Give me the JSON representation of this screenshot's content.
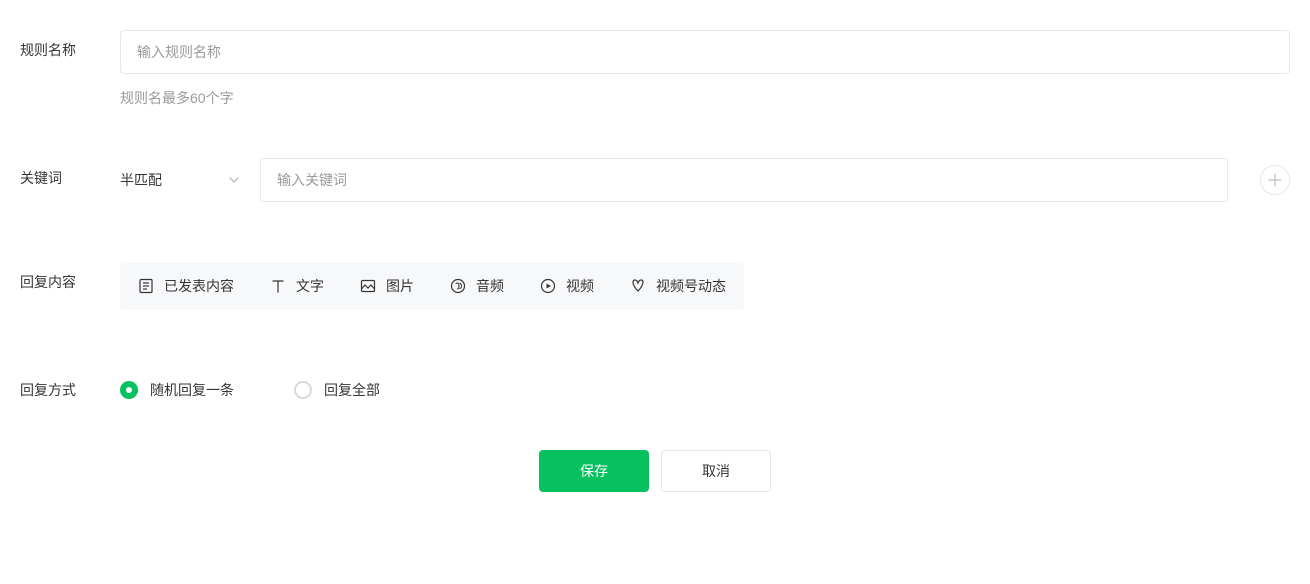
{
  "ruleName": {
    "label": "规则名称",
    "placeholder": "输入规则名称",
    "value": "",
    "hint": "规则名最多60个字"
  },
  "keyword": {
    "label": "关键词",
    "matchType": "半匹配",
    "placeholder": "输入关键词",
    "value": ""
  },
  "replyContent": {
    "label": "回复内容",
    "tabs": [
      "已发表内容",
      "文字",
      "图片",
      "音频",
      "视频",
      "视频号动态"
    ]
  },
  "replyMode": {
    "label": "回复方式",
    "options": [
      "随机回复一条",
      "回复全部"
    ],
    "selectedIndex": 0
  },
  "buttons": {
    "save": "保存",
    "cancel": "取消"
  }
}
